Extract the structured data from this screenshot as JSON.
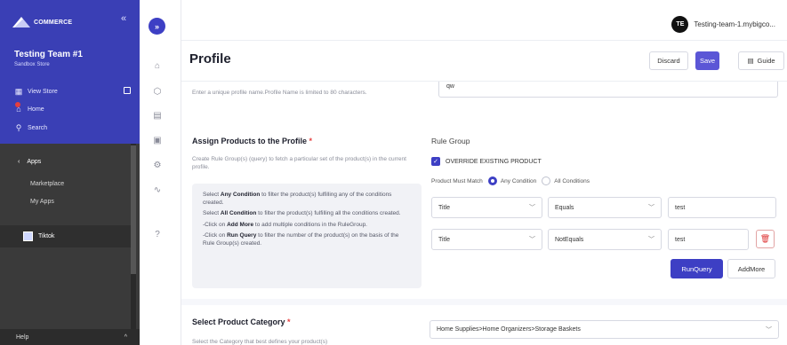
{
  "brand": {
    "logo_text": "COMMERCE",
    "collapse_symbol": "«"
  },
  "sidebar": {
    "team_name": "Testing Team #1",
    "team_sub": "Sandbox Store",
    "view_store": "View Store",
    "home": "Home",
    "search": "Search",
    "apps": "Apps",
    "apps_back_symbol": "‹",
    "marketplace": "Marketplace",
    "my_apps": "My Apps",
    "tiktok": "Tiktok",
    "help": "Help",
    "help_chevron": "^"
  },
  "rail": {
    "expand_symbol": "»"
  },
  "header": {
    "avatar_initials": "TE",
    "user_label": "Testing-team-1.mybigco..."
  },
  "profile": {
    "title": "Profile",
    "discard_label": "Discard",
    "save_label": "Save",
    "guide_label": "Guide"
  },
  "name_section": {
    "help": "Enter a unique profile name.Profile Name is limited to 80 characters.",
    "value": "qw"
  },
  "assign_section": {
    "title": "Assign Products to the Profile",
    "required_mark": "*",
    "desc": "Create Rule Group(s) (query) to fetch a particular set of the product(s) in the current profile.",
    "info": [
      {
        "pre": "Select ",
        "bold": "Any Condition",
        "post": " to filter the product(s) fulfilling any of the conditions created."
      },
      {
        "pre": "Select ",
        "bold": "All Condition",
        "post": " to filter the product(s) fulfilling all the conditions created."
      },
      {
        "pre": "-Click on ",
        "bold": "Add More",
        "post": " to add multiple conditions in the RuleGroup."
      },
      {
        "pre": "-Click on ",
        "bold": "Run Query",
        "post": " to filter the number of the product(s) on the basis of the Rule Group(s) created."
      }
    ]
  },
  "rule_group": {
    "title": "Rule Group",
    "override_label": "OVERRIDE EXISTING PRODUCT",
    "match_label": "Product Must Match",
    "any_condition": "Any Condition",
    "all_conditions": "All Conditions",
    "rows": [
      {
        "field": "Title",
        "operator": "Equals",
        "value": "test"
      },
      {
        "field": "Title",
        "operator": "NotEquals",
        "value": "test"
      }
    ],
    "run_query_label": "RunQuery",
    "add_more_label": "AddMore"
  },
  "category_section": {
    "title": "Select Product Category",
    "required_mark": "*",
    "desc": "Select the Category that best defines your product(s)",
    "value": "Home Supplies>Home Organizers>Storage Baskets"
  },
  "colors": {
    "brand": "#3a3fb5",
    "primary": "#3d3fc4",
    "save": "#5b56d6",
    "danger": "#e53e3e"
  }
}
